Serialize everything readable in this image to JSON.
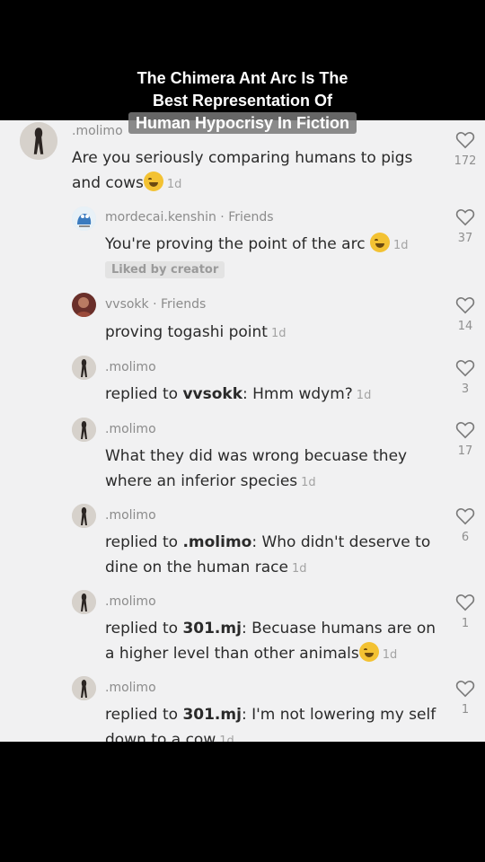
{
  "overlay": {
    "title_line1": "The Chimera Ant Arc Is The",
    "title_line2": "Best Representation Of",
    "title_line3": "Human Hypocrisy In Fiction"
  },
  "comments": [
    {
      "username": ".molimo",
      "friends": "",
      "text": "Are you seriously comparing humans to pigs and cows",
      "emoji": true,
      "time": "1d",
      "likes": "172",
      "icon": "heart-outline-icon"
    },
    {
      "username": "mordecai.kenshin",
      "friends": " · Friends",
      "text": "You're proving the point of the arc",
      "emoji": true,
      "time": "1d",
      "likes": "37",
      "badge": "Liked by creator"
    },
    {
      "username": "vvsokk",
      "friends": " · Friends",
      "text": "proving togashi point",
      "time": "1d",
      "likes": "14"
    },
    {
      "username": ".molimo",
      "reply_prefix": "replied to ",
      "reply_to": "vvsokk",
      "text": ": Hmm wdym?",
      "time": "1d",
      "likes": "3"
    },
    {
      "username": ".molimo",
      "text": "What they did was wrong becuase they where an inferior species",
      "time": "1d",
      "likes": "17"
    },
    {
      "username": ".molimo",
      "reply_prefix": "replied to ",
      "reply_to": ".molimo",
      "text": ": Who didn't deserve to dine on the human race",
      "time": "1d",
      "likes": "6"
    },
    {
      "username": ".molimo",
      "reply_prefix": "replied to ",
      "reply_to": "301.mj",
      "text": ": Becuase humans are on a higher level than other animals",
      "emoji": true,
      "time": "1d",
      "likes": "1"
    },
    {
      "username": ".molimo",
      "reply_prefix": "replied to ",
      "reply_to": "301.mj",
      "text": ": I'm not lowering my self down to a cow",
      "time": "1d",
      "likes": "1"
    }
  ],
  "colors": {
    "panel_bg": "#f1f1f2",
    "text": "#2a2a2a",
    "muted": "#8b8b8b",
    "emoji": "#f3c233"
  }
}
